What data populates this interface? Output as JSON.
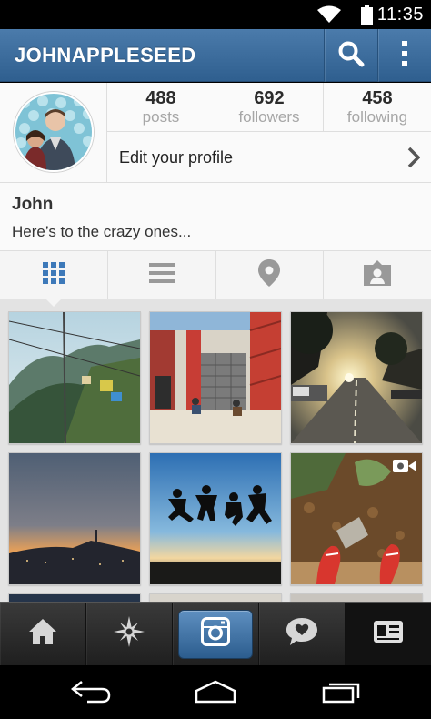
{
  "status_bar": {
    "time": "11:35",
    "icons": [
      "wifi-icon",
      "battery-icon"
    ]
  },
  "action_bar": {
    "title": "JOHNAPPLESEED",
    "icons": [
      "search-icon",
      "overflow-menu-icon"
    ]
  },
  "profile": {
    "counts": [
      {
        "value": "488",
        "label": "posts"
      },
      {
        "value": "692",
        "label": "followers"
      },
      {
        "value": "458",
        "label": "following"
      }
    ],
    "edit_label": "Edit your profile"
  },
  "bio": {
    "name": "John",
    "text": "Here’s to the crazy ones..."
  },
  "tabs": [
    {
      "icon": "grid-view-icon",
      "active": true
    },
    {
      "icon": "list-view-icon",
      "active": false
    },
    {
      "icon": "map-pin-icon",
      "active": false
    },
    {
      "icon": "tagged-photos-icon",
      "active": false
    }
  ],
  "photos": [
    "mountain-cable-car-photo",
    "garage-door-photo",
    "street-sunset-photo",
    "city-dusk-photo",
    "jumping-silhouettes-photo",
    "red-sneakers-video"
  ],
  "bottom_nav": [
    "home-icon",
    "explore-icon",
    "camera-icon",
    "activity-icon",
    "profile-icon"
  ],
  "colors": {
    "accent": "#3d6d9d",
    "active_tab": "#3d79b9"
  }
}
